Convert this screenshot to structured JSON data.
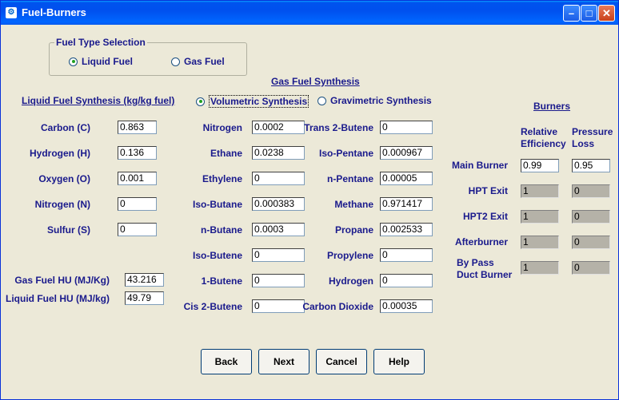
{
  "window": {
    "title": "Fuel-Burners",
    "icon": "app-icon"
  },
  "fuel_type": {
    "legend": "Fuel Type Selection",
    "liquid_label": "Liquid Fuel",
    "gas_label": "Gas Fuel",
    "selected": "liquid"
  },
  "gas_synthesis": {
    "heading": "Gas Fuel Synthesis",
    "volumetric_label": "Volumetric Synthesis",
    "gravimetric_label": "Gravimetric Synthesis",
    "selected": "volumetric",
    "col1": [
      {
        "label": "Nitrogen",
        "value": "0.0002"
      },
      {
        "label": "Ethane",
        "value": "0.0238"
      },
      {
        "label": "Ethylene",
        "value": "0"
      },
      {
        "label": "Iso-Butane",
        "value": "0.000383"
      },
      {
        "label": "n-Butane",
        "value": "0.0003"
      },
      {
        "label": "Iso-Butene",
        "value": "0"
      },
      {
        "label": "1-Butene",
        "value": "0"
      },
      {
        "label": "Cis 2-Butene",
        "value": "0"
      }
    ],
    "col2": [
      {
        "label": "Trans 2-Butene",
        "value": "0"
      },
      {
        "label": "Iso-Pentane",
        "value": "0.000967"
      },
      {
        "label": "n-Pentane",
        "value": "0.00005"
      },
      {
        "label": "Methane",
        "value": "0.971417"
      },
      {
        "label": "Propane",
        "value": "0.002533"
      },
      {
        "label": "Propylene",
        "value": "0"
      },
      {
        "label": "Hydrogen",
        "value": "0"
      },
      {
        "label": "Carbon Dioxide",
        "value": "0.00035"
      }
    ]
  },
  "liquid_synthesis": {
    "heading": "Liquid Fuel Synthesis (kg/kg fuel)",
    "rows": [
      {
        "label": "Carbon (C)",
        "value": "0.863"
      },
      {
        "label": "Hydrogen (H)",
        "value": "0.136"
      },
      {
        "label": "Oxygen (O)",
        "value": "0.001"
      },
      {
        "label": "Nitrogen (N)",
        "value": "0"
      },
      {
        "label": "Sulfur (S)",
        "value": "0"
      }
    ]
  },
  "heating_values": {
    "gas_label": "Gas Fuel HU (MJ/Kg)",
    "gas_value": "43.216",
    "liquid_label": "Liquid Fuel HU (MJ/kg)",
    "liquid_value": "49.79"
  },
  "burners": {
    "heading": "Burners",
    "col_eff_1": "Relative",
    "col_eff_2": "Efficiency",
    "col_loss_1": "Pressure",
    "col_loss_2": "Loss",
    "rows": [
      {
        "label": "Main  Burner",
        "efficiency": "0.99",
        "loss": "0.95",
        "enabled": true
      },
      {
        "label": "HPT Exit",
        "efficiency": "1",
        "loss": "0",
        "enabled": false
      },
      {
        "label": "HPT2 Exit",
        "efficiency": "1",
        "loss": "0",
        "enabled": false
      },
      {
        "label": "Afterburner",
        "efficiency": "1",
        "loss": "0",
        "enabled": false
      },
      {
        "label": "By Pass",
        "label2": "Duct Burner",
        "efficiency": "1",
        "loss": "0",
        "enabled": false
      }
    ]
  },
  "buttons": {
    "back": "Back",
    "next": "Next",
    "cancel": "Cancel",
    "help": "Help"
  }
}
